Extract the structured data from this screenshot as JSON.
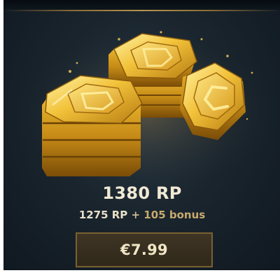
{
  "offer": {
    "total_label": "1380 RP",
    "base_amount": "1275 RP",
    "plus_sign": "+",
    "bonus_amount": "105 bonus",
    "price_label": "€7.99"
  },
  "colors": {
    "card_background": "#1a252e",
    "gold_accent": "#c8aa6e",
    "button_border": "#7a6031",
    "text_light": "#f0e9d4"
  },
  "icons": {
    "artwork": "riot-points-coin-stacks"
  }
}
